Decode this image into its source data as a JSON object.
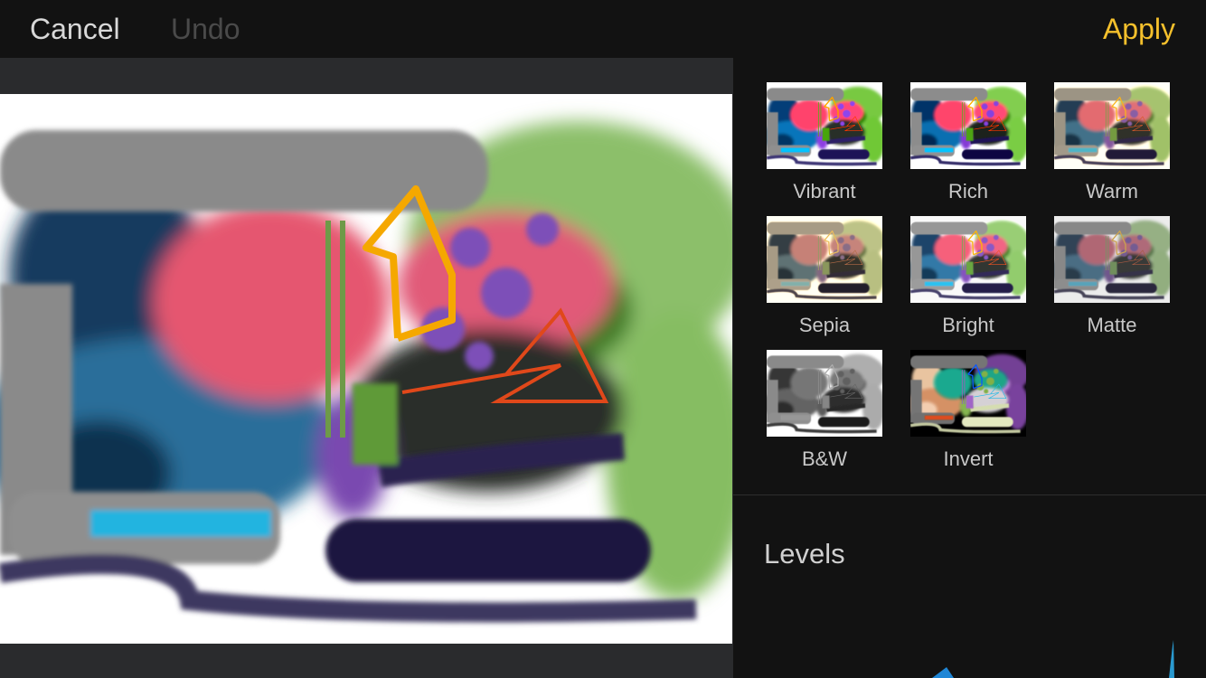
{
  "toolbar": {
    "cancel_label": "Cancel",
    "undo_label": "Undo",
    "apply_label": "Apply",
    "accent_color": "#f5c02c"
  },
  "filters": [
    {
      "label": "Vibrant",
      "css": "saturate(1.6)"
    },
    {
      "label": "Rich",
      "css": "saturate(1.3) contrast(1.15)"
    },
    {
      "label": "Warm",
      "css": "sepia(0.35) saturate(1.2)"
    },
    {
      "label": "Sepia",
      "css": "sepia(0.6)"
    },
    {
      "label": "Bright",
      "css": "brightness(1.1) contrast(0.95)"
    },
    {
      "label": "Matte",
      "css": "saturate(0.6) contrast(0.85)"
    },
    {
      "label": "B&W",
      "css": "grayscale(1)"
    },
    {
      "label": "Invert",
      "css": "invert(1)"
    }
  ],
  "levels": {
    "title": "Levels"
  }
}
